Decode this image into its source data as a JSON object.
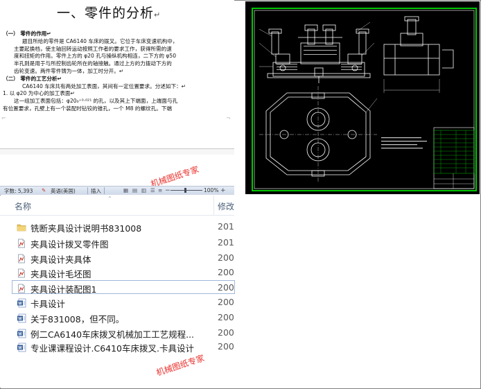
{
  "document": {
    "title": "一、零件的分析",
    "title_mark": "↵",
    "lines": [
      {
        "text": "（一） 零件的作用↵",
        "cls": "h"
      },
      {
        "text": "题目所给的零件是 CA6140 车床的拨叉。它位于车床变速机构中，",
        "cls": "ind"
      },
      {
        "text": "主要起换档，使主轴回转运动按照工作者的要求工作，获得所需的速",
        "cls": "ind2"
      },
      {
        "text": "度和扭矩的作用。零件上方的 φ20 孔与操纵机构相连，二下方的 φ50",
        "cls": "ind2"
      },
      {
        "text": "半孔则是用于与所控制齿轮所在的轴接触。通过上方的力拨动下方的",
        "cls": "ind2"
      },
      {
        "text": "齿轮变速。两件零件铸为一体，加工时分开。↵",
        "cls": "ind2"
      },
      {
        "text": "（二） 零件的工艺分析↵",
        "cls": "h"
      },
      {
        "text": "CA6140 车床共有两处加工表面，其间有一定位置要求。分述如下：↵",
        "cls": "ind"
      },
      {
        "text": "1.   以 φ20 为中心的加工表面↵",
        "cls": ""
      },
      {
        "text": "这一组加工表面包括：φ20₀⁺⁰·⁰²¹ 的孔，以及其上下端面，上端面与孔",
        "cls": "ind2"
      },
      {
        "text": "有位置要求，孔壁上有一个装配时钻铰的锥孔，一个 M8 的螺纹孔。下端",
        "cls": ""
      }
    ]
  },
  "status_bar": {
    "word_count": "字数: 5,393",
    "language": "英语(美国)",
    "mode": "插入",
    "zoom": "100%",
    "zoom_level_percent": 100
  },
  "watermarks": [
    "机械图纸专家",
    "机械图纸专家"
  ],
  "explorer": {
    "columns": {
      "name": "名称",
      "modified": "修改"
    },
    "files": [
      {
        "name": "铣断夹具设计说明书831008",
        "mod": "201",
        "icon": "folder-icon"
      },
      {
        "name": "夹具设计拨叉零件图",
        "mod": "201",
        "icon": "dwg-file-icon"
      },
      {
        "name": "夹具设计夹具体",
        "mod": "200",
        "icon": "dwg-file-icon"
      },
      {
        "name": "夹具设计毛坯图",
        "mod": "200",
        "icon": "dwg-file-icon"
      },
      {
        "name": "夹具设计装配图1",
        "mod": "200",
        "icon": "dwg-file-icon",
        "selected": true
      },
      {
        "name": "卡具设计",
        "mod": "200",
        "icon": "word-file-icon"
      },
      {
        "name": "关于831008，但不同。",
        "mod": "200",
        "icon": "word-file-icon"
      },
      {
        "name": "例二CA6140车床拨叉机械加工工艺规程...",
        "mod": "200",
        "icon": "word-file-icon"
      },
      {
        "name": "专业课课程设计.C6410车床拨叉.卡具设计",
        "mod": "200",
        "icon": "word-file-icon"
      }
    ]
  },
  "colors": {
    "cad_background": "#000000",
    "cad_border": "#00c800",
    "cad_lines": "#ffffff",
    "watermark": "#e8413c"
  }
}
